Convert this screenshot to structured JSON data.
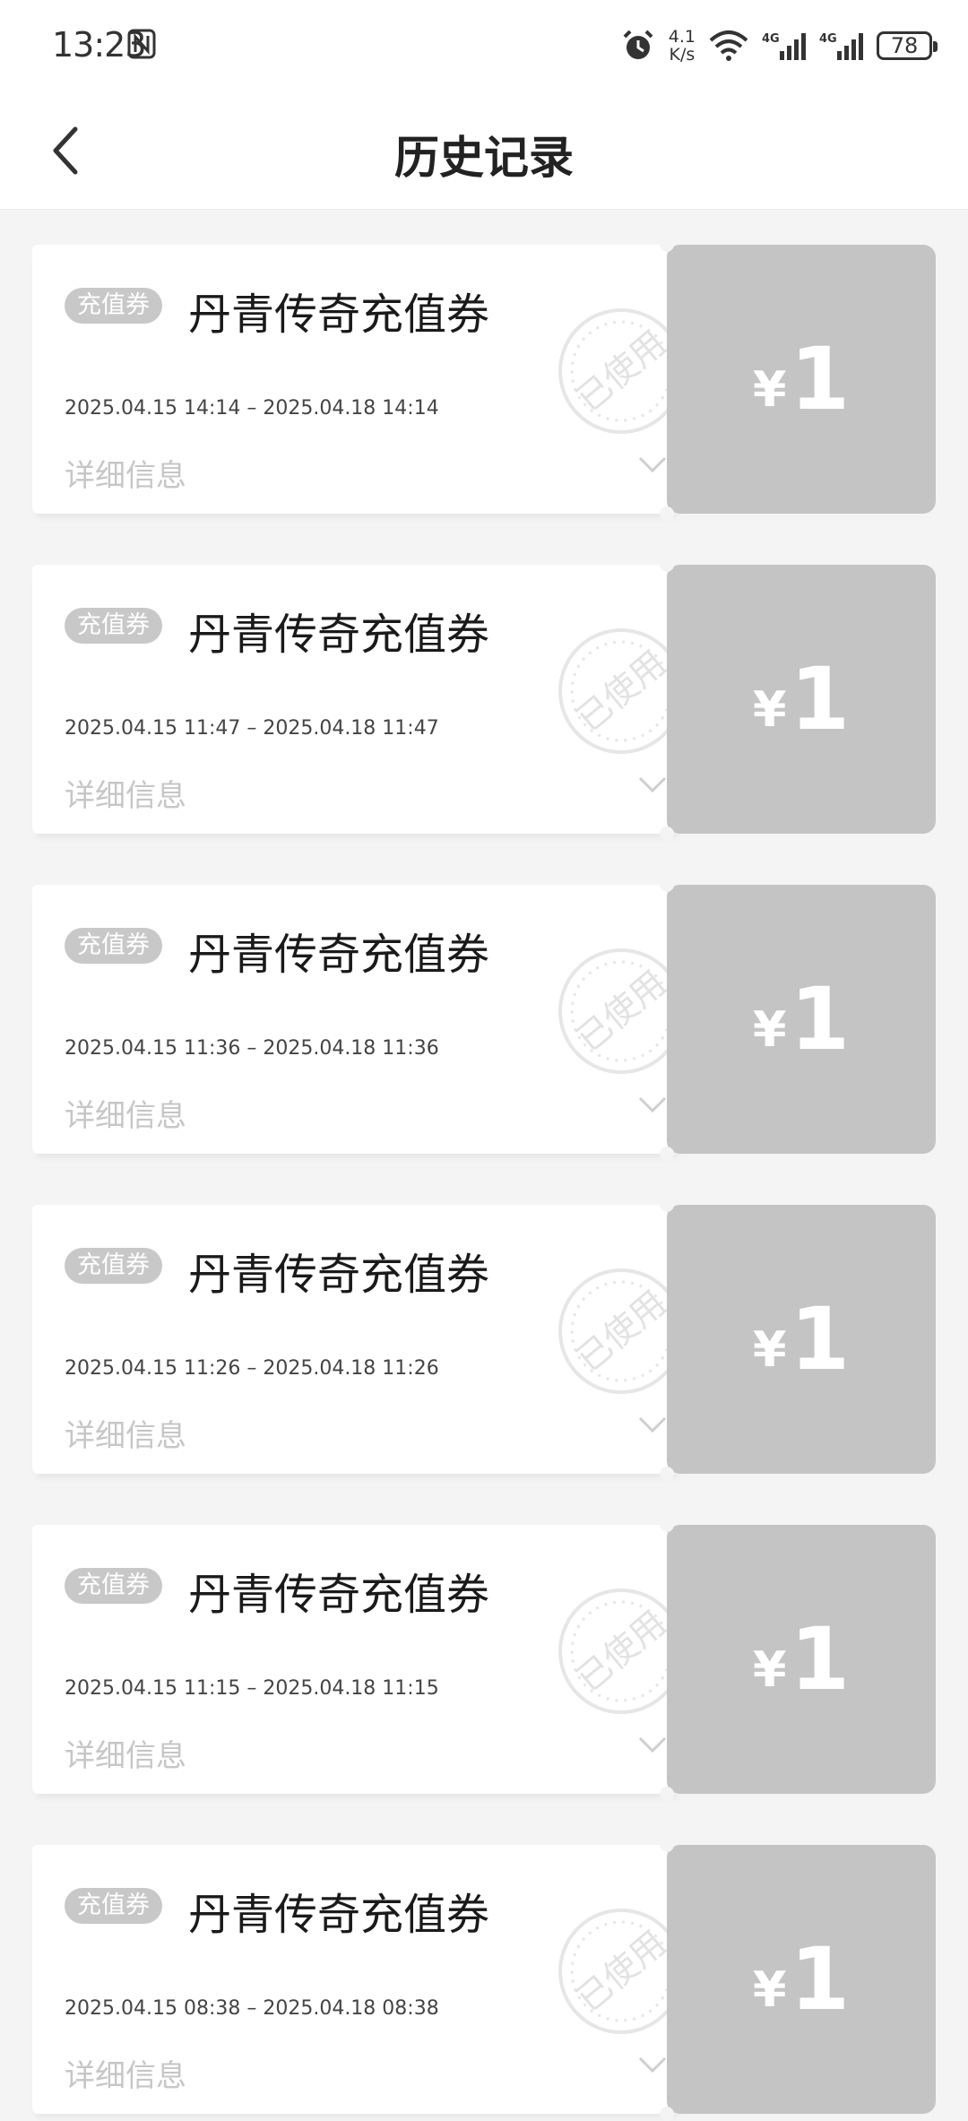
{
  "status": {
    "time": "13:23",
    "net_speed_value": "4.1",
    "net_speed_unit": "K/s",
    "battery": "78"
  },
  "header": {
    "title": "历史记录"
  },
  "coupons": [
    {
      "tag": "充值券",
      "title": "丹青传奇充值券",
      "date": "2025.04.15 14:14 – 2025.04.18 14:14",
      "detail": "详细信息",
      "stamp": "已使用",
      "currency": "¥",
      "amount": "1"
    },
    {
      "tag": "充值券",
      "title": "丹青传奇充值券",
      "date": "2025.04.15 11:47 – 2025.04.18 11:47",
      "detail": "详细信息",
      "stamp": "已使用",
      "currency": "¥",
      "amount": "1"
    },
    {
      "tag": "充值券",
      "title": "丹青传奇充值券",
      "date": "2025.04.15 11:36 – 2025.04.18 11:36",
      "detail": "详细信息",
      "stamp": "已使用",
      "currency": "¥",
      "amount": "1"
    },
    {
      "tag": "充值券",
      "title": "丹青传奇充值券",
      "date": "2025.04.15 11:26 – 2025.04.18 11:26",
      "detail": "详细信息",
      "stamp": "已使用",
      "currency": "¥",
      "amount": "1"
    },
    {
      "tag": "充值券",
      "title": "丹青传奇充值券",
      "date": "2025.04.15 11:15 – 2025.04.18 11:15",
      "detail": "详细信息",
      "stamp": "已使用",
      "currency": "¥",
      "amount": "1"
    },
    {
      "tag": "充值券",
      "title": "丹青传奇充值券",
      "date": "2025.04.15 08:38 – 2025.04.18 08:38",
      "detail": "详细信息",
      "stamp": "已使用",
      "currency": "¥",
      "amount": "1"
    }
  ],
  "icons": {
    "back": "chevron-left-icon",
    "expand": "chevron-down-icon",
    "stamp": "used-stamp-icon",
    "alarm": "alarm-icon",
    "wifi": "wifi-icon",
    "signal": "signal-icon",
    "nfc": "nfc-icon",
    "battery": "battery-icon"
  },
  "colors": {
    "background": "#f4f4f4",
    "card": "#ffffff",
    "price_panel": "#c4c4c4",
    "tag": "#c8c8c8",
    "muted_text": "#c6c6c6"
  }
}
